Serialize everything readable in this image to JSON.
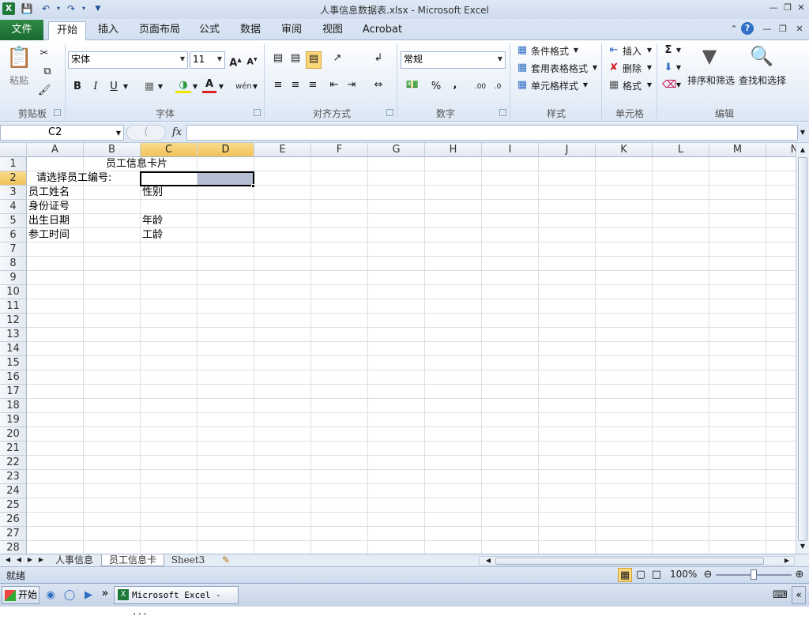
{
  "window": {
    "title": "人事信息数据表.xlsx  -  Microsoft Excel"
  },
  "qat": {
    "icons": [
      "excel-logo",
      "save-icon",
      "undo-icon",
      "redo-icon",
      "customize-icon"
    ]
  },
  "tabs": [
    "文件",
    "开始",
    "插入",
    "页面布局",
    "公式",
    "数据",
    "审阅",
    "视图",
    "Acrobat"
  ],
  "ribbon": {
    "clipboard": {
      "paste": "粘贴",
      "group": "剪贴板"
    },
    "font": {
      "name": "宋体",
      "size": "11",
      "group": "字体",
      "bold": "B",
      "italic": "I",
      "underline": "U"
    },
    "align": {
      "group": "对齐方式"
    },
    "number": {
      "format": "常规",
      "percent": "%",
      "comma": ",",
      "group": "数字"
    },
    "styles": {
      "cond": "条件格式",
      "table": "套用表格格式",
      "cell": "单元格样式",
      "group": "样式"
    },
    "cells": {
      "insert": "插入",
      "delete": "删除",
      "format": "格式",
      "group": "单元格"
    },
    "editing": {
      "sort": "排序和筛选",
      "find": "查找和选择",
      "group": "编辑",
      "sum": "Σ"
    }
  },
  "formula_bar": {
    "name_box": "C2",
    "fx": "fx"
  },
  "grid": {
    "columns": [
      "A",
      "B",
      "C",
      "D",
      "E",
      "F",
      "G",
      "H",
      "I",
      "J",
      "K",
      "L",
      "M",
      "N"
    ],
    "rows": [
      "1",
      "2",
      "3",
      "4",
      "5",
      "6",
      "7",
      "8",
      "9",
      "10",
      "11",
      "12",
      "13",
      "14",
      "15",
      "16",
      "17",
      "18",
      "19",
      "20",
      "21",
      "22",
      "23",
      "24",
      "25",
      "26",
      "27",
      "28"
    ],
    "cells": {
      "title": "员工信息卡片",
      "prompt": "请选择员工编号:",
      "name": "员工姓名",
      "gender": "性别",
      "id": "身份证号",
      "birth": "出生日期",
      "age": "年龄",
      "join": "参工时间",
      "tenure": "工龄"
    }
  },
  "sheets": [
    "人事信息",
    "员工信息卡",
    "Sheet3"
  ],
  "status": {
    "ready": "就绪",
    "zoom": "100%"
  },
  "taskbar": {
    "start": "开始",
    "app": "Microsoft Excel - ..."
  }
}
